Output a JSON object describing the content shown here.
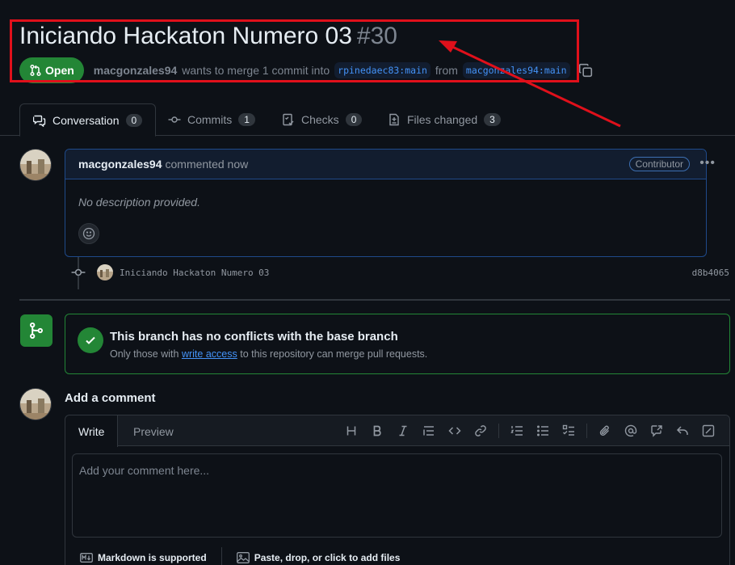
{
  "pr": {
    "title": "Iniciando Hackaton Numero 03",
    "number": "#30",
    "state": "Open",
    "author": "macgonzales94",
    "merge_text": "wants to merge 1 commit into",
    "base_branch": "rpinedaec83:main",
    "from_text": "from",
    "head_branch": "macgonzales94:main"
  },
  "tabs": [
    {
      "label": "Conversation",
      "count": "0",
      "icon": "comment-discussion-icon"
    },
    {
      "label": "Commits",
      "count": "1",
      "icon": "commit-icon"
    },
    {
      "label": "Checks",
      "count": "0",
      "icon": "checklist-icon"
    },
    {
      "label": "Files changed",
      "count": "3",
      "icon": "file-diff-icon"
    }
  ],
  "comment": {
    "author": "macgonzales94",
    "action": "commented now",
    "badge": "Contributor",
    "body": "No description provided."
  },
  "commit": {
    "message": "Iniciando Hackaton Numero 03",
    "sha": "d8b4065"
  },
  "merge": {
    "title": "This branch has no conflicts with the base branch",
    "sub_prefix": "Only those with",
    "sub_link": "write access",
    "sub_suffix": "to this repository can merge pull requests."
  },
  "add_comment": {
    "title": "Add a comment",
    "tab_write": "Write",
    "tab_preview": "Preview",
    "placeholder": "Add your comment here...",
    "markdown_note": "Markdown is supported",
    "attach_note": "Paste, drop, or click to add files"
  },
  "colors": {
    "annotation": "#e0101b",
    "open_green": "#238636",
    "link_blue": "#4493f8",
    "background": "#0d1117"
  }
}
